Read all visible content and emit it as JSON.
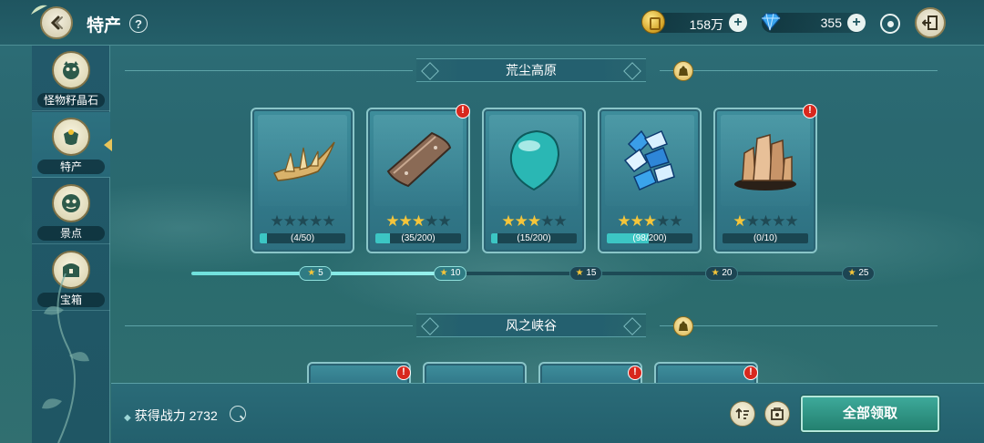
{
  "header": {
    "title": "特产",
    "help_label": "?"
  },
  "currency": {
    "gold_value": "158万",
    "gem_value": "355",
    "plus_label": "+"
  },
  "sidebar": {
    "items": [
      {
        "label": "怪物籽晶石",
        "icon": "monster-icon",
        "active": false
      },
      {
        "label": "特产",
        "icon": "specialty-icon",
        "active": true
      },
      {
        "label": "景点",
        "icon": "scenic-icon",
        "active": false
      },
      {
        "label": "宝箱",
        "icon": "chest-icon",
        "active": false
      }
    ]
  },
  "sections": [
    {
      "title": "荒尘高原",
      "items": [
        {
          "name": "claw-item",
          "stars": 0,
          "progress_text": "(4/50)",
          "progress": 0.08,
          "alert": false
        },
        {
          "name": "plank-item",
          "stars": 3,
          "progress_text": "(35/200)",
          "progress": 0.175,
          "alert": true
        },
        {
          "name": "teal-gem-item",
          "stars": 3,
          "progress_text": "(15/200)",
          "progress": 0.075,
          "alert": false
        },
        {
          "name": "blue-scales-item",
          "stars": 3,
          "progress_text": "(98/200)",
          "progress": 0.49,
          "alert": false
        },
        {
          "name": "rock-crystal-item",
          "stars": 1,
          "progress_text": "(0/10)",
          "progress": 0.0,
          "alert": true
        }
      ],
      "milestones": [
        {
          "label": "5",
          "reached": true
        },
        {
          "label": "10",
          "reached": true
        },
        {
          "label": "15",
          "reached": false
        },
        {
          "label": "20",
          "reached": false
        },
        {
          "label": "25",
          "reached": false
        }
      ],
      "track_progress": 0.4
    },
    {
      "title": "风之峡谷"
    }
  ],
  "footer": {
    "power_label": "获得战力",
    "power_value": "2732",
    "claim_label": "全部领取"
  },
  "colors": {
    "accent": "#3cc6c4",
    "star": "#f5c53a",
    "alert": "#d8281e"
  }
}
